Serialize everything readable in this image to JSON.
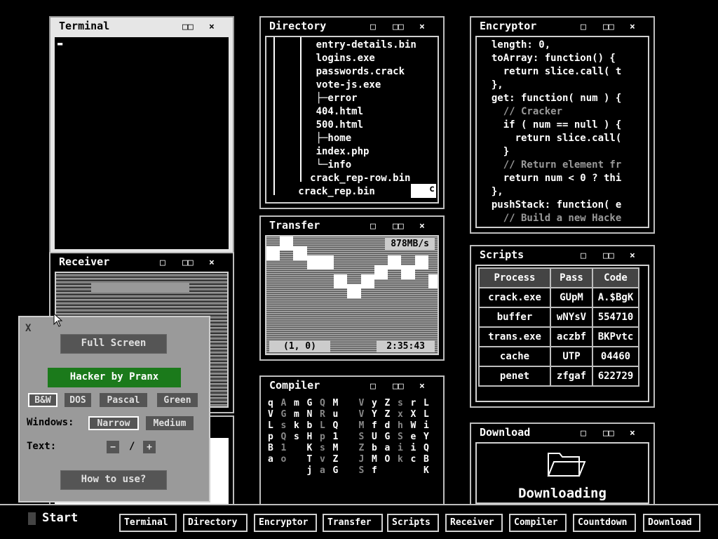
{
  "terminal": {
    "title": "Terminal",
    "controls": [
      "□□",
      "×"
    ],
    "cursor": "▬"
  },
  "receiver": {
    "title": "Receiver",
    "controls": [
      "□",
      "□□",
      "×"
    ]
  },
  "directory": {
    "title": "Directory",
    "controls": [
      "□",
      "□□",
      "×"
    ],
    "lines": [
      "      entry-details.bin",
      "      logins.exe",
      "      passwords.crack",
      "      vote-js.exe",
      "      ├─error",
      "      404.html",
      "      500.html",
      "      ├─home",
      "      index.php",
      "      └─info",
      "     crack_rep-row.bin",
      "   crack_rep.bin"
    ],
    "badge": "c"
  },
  "encryptor": {
    "title": "Encryptor",
    "controls": [
      "□",
      "□□",
      "×"
    ],
    "lines": [
      {
        "t": "  length: 0,",
        "c": false
      },
      {
        "t": "  toArray: function() {",
        "c": false
      },
      {
        "t": "    return slice.call( t",
        "c": false
      },
      {
        "t": "  },",
        "c": false
      },
      {
        "t": "  get: function( num ) {",
        "c": false
      },
      {
        "t": "    // Cracker",
        "c": true
      },
      {
        "t": "    if ( num == null ) {",
        "c": false
      },
      {
        "t": "      return slice.call(",
        "c": false
      },
      {
        "t": "    }",
        "c": false
      },
      {
        "t": "    // Return element fr",
        "c": true
      },
      {
        "t": "    return num < 0 ? thi",
        "c": false
      },
      {
        "t": "  },",
        "c": false
      },
      {
        "t": "  pushStack: function( e",
        "c": false
      },
      {
        "t": "    // Build a new Hacke",
        "c": true
      }
    ]
  },
  "transfer": {
    "title": "Transfer",
    "controls": [
      "□",
      "□□",
      "×"
    ],
    "speed": "878MB/s",
    "coords": "(1, 0)",
    "time": "2:35:43",
    "levels": [
      0.15,
      0.0,
      0.15,
      0.3,
      0.3,
      0.6,
      0.75,
      0.6,
      0.45,
      0.3,
      0.45,
      0.3,
      0.6
    ]
  },
  "scripts": {
    "title": "Scripts",
    "controls": [
      "□",
      "□□",
      "×"
    ],
    "headers": [
      "Process",
      "Pass",
      "Code"
    ],
    "rows": [
      [
        "crack.exe",
        "GUpM",
        "A.$BgK"
      ],
      [
        "buffer",
        "wNYsV",
        "554710"
      ],
      [
        "trans.exe",
        "aczbf",
        "BKPvtc"
      ],
      [
        "cache",
        "UTP",
        "04460"
      ],
      [
        "penet",
        "zfgaf",
        "622729"
      ]
    ]
  },
  "compiler": {
    "title": "Compiler",
    "controls": [
      "□",
      "□□",
      "×"
    ],
    "columns": [
      "qVLpBa",
      "AGsQ1o",
      "mmks",
      "GNbHKTj",
      "QRLpsva",
      "MuQ1MZG",
      "",
      "VVMSZJS",
      "yYfUbMf",
      "ZZdGaO",
      "sxhSik",
      "rXWeic",
      "LLiYQBK"
    ]
  },
  "download": {
    "title": "Download",
    "controls": [
      "□",
      "□□",
      "×"
    ],
    "status": "Downloading"
  },
  "panel": {
    "close": "X",
    "fullscreen": "Full Screen",
    "brand": "Hacker by Pranx",
    "themes": [
      "B&W",
      "DOS",
      "Pascal",
      "Green"
    ],
    "windows_label": "Windows:",
    "window_opts": [
      "Narrow",
      "Medium"
    ],
    "text_label": "Text:",
    "minus": "−",
    "slash": "/",
    "plus": "+",
    "help": "How to use?"
  },
  "taskbar": {
    "start": "Start",
    "buttons": [
      "Terminal",
      "Directory",
      "Encryptor",
      "Transfer",
      "Scripts",
      "Receiver",
      "Compiler",
      "Countdown",
      "Download"
    ]
  }
}
